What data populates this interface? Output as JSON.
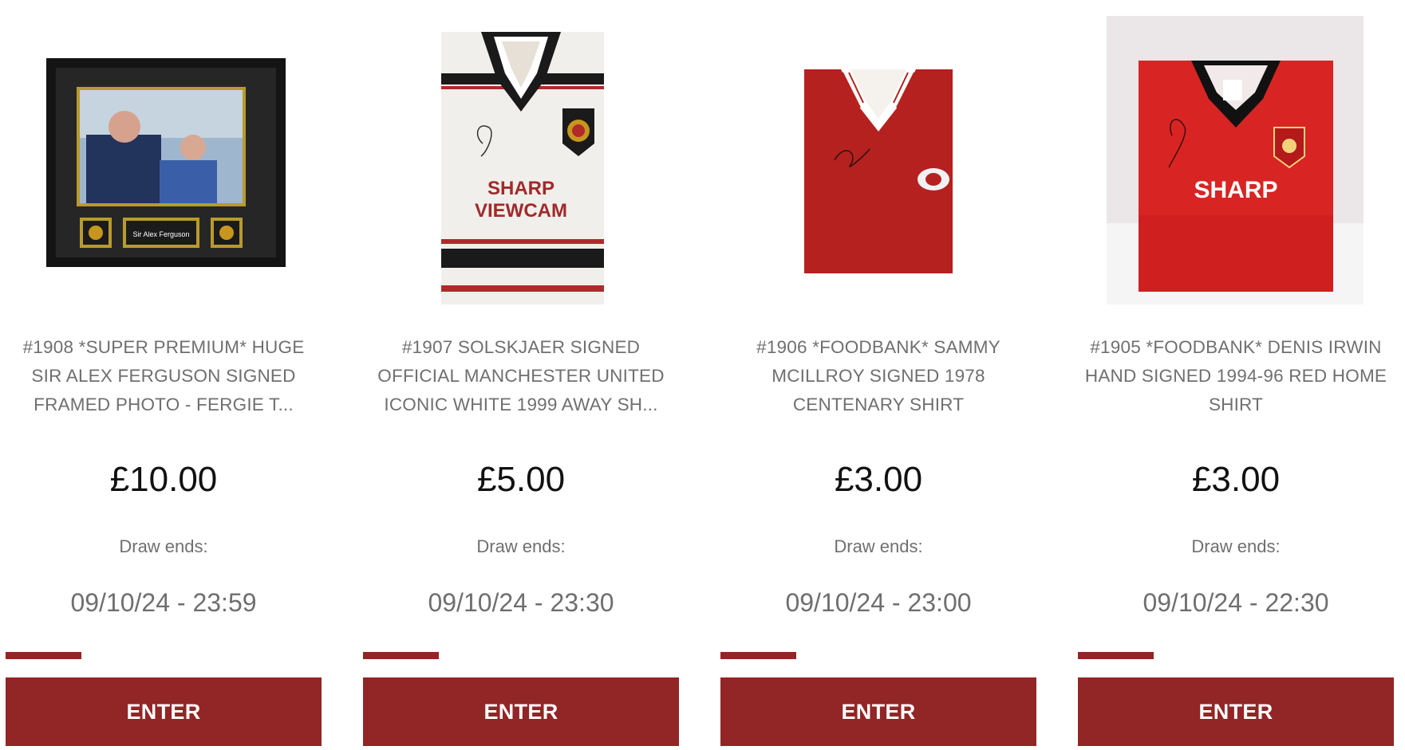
{
  "accent_color": "#922525",
  "cards": [
    {
      "title": "#1908 *SUPER PREMIUM* HUGE SIR ALEX FERGUSON SIGNED FRAMED PHOTO - FERGIE T...",
      "image": "framed-photo",
      "frame_nameplate": "Sir Alex Ferguson",
      "price": "£10.00",
      "draw_label": "Draw ends:",
      "draw_date": "09/10/24 - 23:59",
      "progress": 0.24,
      "button_label": "ENTER"
    },
    {
      "title": "#1907 SOLSKJAER SIGNED OFFICIAL MANCHESTER UNITED ICONIC WHITE 1999 AWAY SH...",
      "image": "white-away-shirt",
      "shirt_sponsor_line1": "SHARP",
      "shirt_sponsor_line2": "VIEWCAM",
      "price": "£5.00",
      "draw_label": "Draw ends:",
      "draw_date": "09/10/24 - 23:30",
      "progress": 0.24,
      "button_label": "ENTER"
    },
    {
      "title": "#1906 *FOODBANK* SAMMY MCILLROY SIGNED 1978 CENTENARY SHIRT",
      "image": "red-centenary-shirt",
      "price": "£3.00",
      "draw_label": "Draw ends:",
      "draw_date": "09/10/24 - 23:00",
      "progress": 0.24,
      "button_label": "ENTER"
    },
    {
      "title": "#1905 *FOODBANK* DENIS IRWIN HAND SIGNED 1994-96 RED HOME SHIRT",
      "image": "red-home-shirt",
      "shirt_sponsor_line1": "SHARP",
      "price": "£3.00",
      "draw_label": "Draw ends:",
      "draw_date": "09/10/24 - 22:30",
      "progress": 0.24,
      "button_label": "ENTER"
    }
  ]
}
